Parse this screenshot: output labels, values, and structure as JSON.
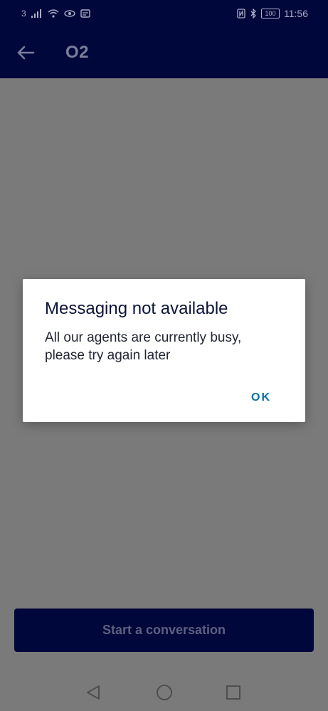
{
  "status_bar": {
    "carrier": "3",
    "battery": "100",
    "time": "11:56"
  },
  "app_bar": {
    "title": "O2",
    "back_icon": "arrow-left-icon"
  },
  "main": {
    "start_button_label": "Start a conversation"
  },
  "dialog": {
    "title": "Messaging not available",
    "message": "All our agents are currently busy, please try again later",
    "ok_label": "OK"
  },
  "colors": {
    "brand_navy": "#000f7a",
    "accent_link": "#0a6fa8"
  }
}
